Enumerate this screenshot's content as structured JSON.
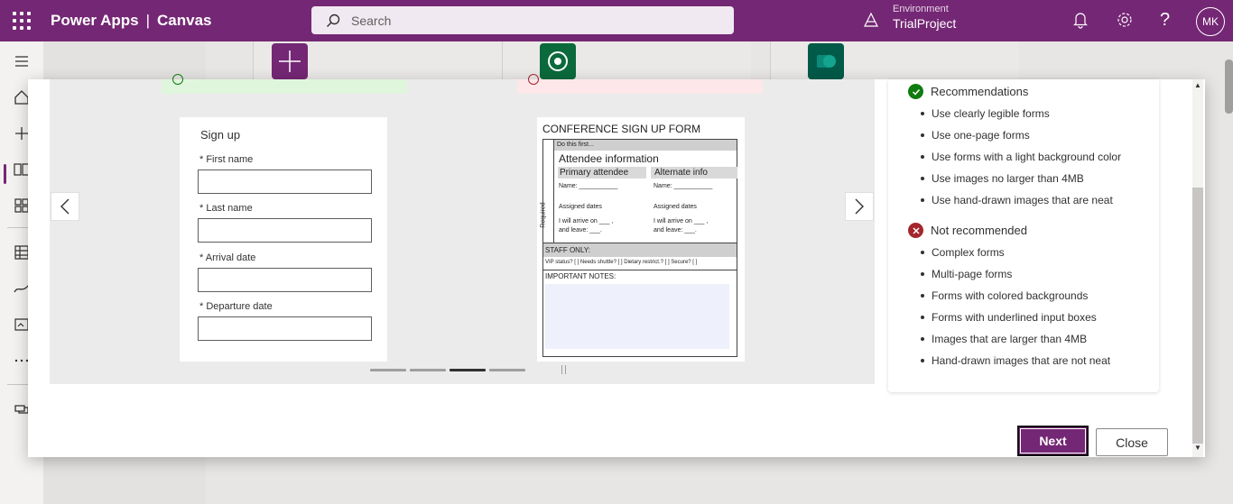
{
  "topbar": {
    "app_name": "Power Apps",
    "section": "Canvas",
    "search_placeholder": "Search",
    "environment_label": "Environment",
    "environment_value": "TrialProject",
    "avatar_initials": "MK",
    "help_glyph": "?",
    "color": "#742774"
  },
  "leftnav": {
    "icons": [
      "hamburger-icon",
      "home-icon",
      "create-icon",
      "learn-icon",
      "apps-icon",
      "tables-icon",
      "flows-icon",
      "solutions-icon",
      "more-icon",
      "power-platform-icon"
    ]
  },
  "modal": {
    "good_example": {
      "title": "Sign up",
      "fields": [
        "* First name",
        "* Last name",
        "* Arrival date",
        "* Departure date"
      ]
    },
    "bad_example": {
      "title": "CONFERENCE SIGN UP FORM",
      "do_first": "Do this first...",
      "required": "Required",
      "attendee": "Attendee information",
      "primary": "Primary attendee",
      "alternate": "Alternate info",
      "name_label": "Name: ___________",
      "assigned": "Assigned dates",
      "arrive": "I will arrive on ___ ,",
      "leave": "and leave: ___.",
      "staff": "STAFF ONLY:",
      "staff_line": "VIP status? [ ]  Needs shuttle? [ ]  Dietary restrict.? [ ]  Secure? [ ]",
      "notes": "IMPORTANT NOTES:"
    },
    "carousel": {
      "slides": 4,
      "active_index": 2
    },
    "recommendations": {
      "title": "Recommendations",
      "items": [
        "Use clearly legible forms",
        "Use one-page forms",
        "Use forms with a light background color",
        "Use images no larger than 4MB",
        "Use hand-drawn images that are neat"
      ]
    },
    "not_recommended": {
      "title": "Not recommended",
      "items": [
        "Complex forms",
        "Multi-page forms",
        "Forms with colored backgrounds",
        "Forms with underlined input boxes",
        "Images that are larger than 4MB",
        "Hand-drawn images that are not neat"
      ]
    },
    "next_label": "Next",
    "close_label": "Close"
  }
}
